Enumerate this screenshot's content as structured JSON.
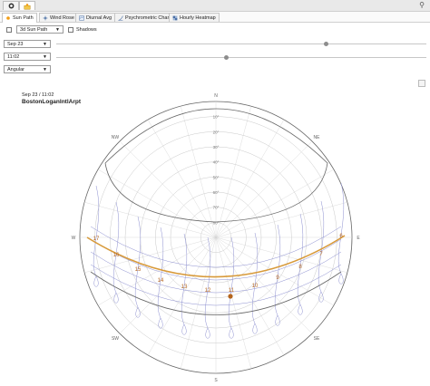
{
  "app_tabs": [
    {
      "icon": "dark-globe-icon"
    },
    {
      "icon": "folder-sun-icon",
      "active": true
    }
  ],
  "tabs": [
    {
      "label": "Sun Path",
      "icon": "sun-path-icon",
      "active": true
    },
    {
      "label": "Wind Rose",
      "icon": "wind-rose-icon"
    },
    {
      "label": "Diurnal Avg",
      "icon": "diurnal-icon"
    },
    {
      "label": "Psychrometric Chart",
      "icon": "psychrometric-icon"
    },
    {
      "label": "Hourly Heatmap",
      "icon": "heatmap-icon"
    }
  ],
  "controls": {
    "view_mode": "3d Sun Path",
    "shadows_label": "Shadows",
    "date_value": "Sep 23",
    "time_value": "11:02",
    "projection_value": "Angular",
    "date_slider_fraction": 0.73,
    "time_slider_fraction": 0.46
  },
  "plot": {
    "info_datetime": "Sep 23 / 11:02",
    "station": "BostonLoganIntlArpt",
    "compass": {
      "N": "N",
      "NE": "NE",
      "E": "E",
      "SE": "SE",
      "S": "S",
      "SW": "SW",
      "W": "W",
      "NW": "NW"
    },
    "altitude_labels": [
      "10°",
      "20°",
      "30°",
      "40°",
      "50°",
      "60°",
      "70°",
      "80°"
    ],
    "hour_labels": [
      "17",
      "16",
      "15",
      "14",
      "13",
      "12",
      "11",
      "10",
      "9",
      "8",
      "7",
      "6"
    ],
    "current_hour_label": "11",
    "sun_path_color": "#d89a3a",
    "current_sun_color": "#b5651d",
    "analemma_color": "#8c8fd0"
  }
}
